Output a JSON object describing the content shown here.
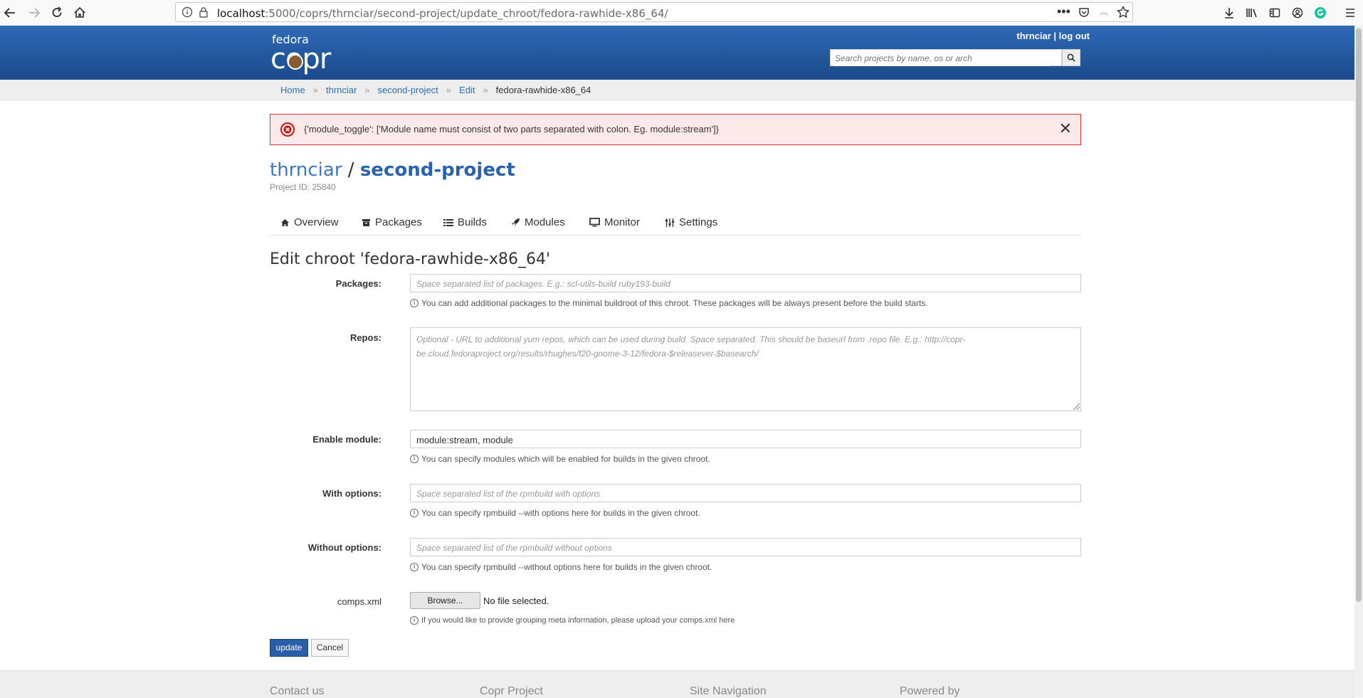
{
  "browser": {
    "url_host": "localhost",
    "url_rest": ":5000/coprs/thrnciar/second-project/update_chroot/fedora-rawhide-x86_64/"
  },
  "header": {
    "logo_top": "fedora",
    "logo_main": "copr",
    "username": "thrnciar",
    "separator": "|",
    "logout": "log out",
    "search_placeholder": "Search projects by name, os or arch"
  },
  "breadcrumb": {
    "items": [
      "Home",
      "thrnciar",
      "second-project",
      "Edit"
    ],
    "current": "fedora-rawhide-x86_64",
    "separator": "»"
  },
  "alert": {
    "message": "{'module_toggle': ['Module name must consist of two parts separated with colon. Eg. module:stream']}",
    "close": "✕"
  },
  "project": {
    "owner": "thrnciar",
    "slash": "/",
    "name": "second-project",
    "id_label": "Project ID: 25840"
  },
  "tabs": [
    {
      "label": "Overview",
      "icon": "home-icon"
    },
    {
      "label": "Packages",
      "icon": "archive-icon"
    },
    {
      "label": "Builds",
      "icon": "list-icon"
    },
    {
      "label": "Modules",
      "icon": "rocket-icon"
    },
    {
      "label": "Monitor",
      "icon": "monitor-icon"
    },
    {
      "label": "Settings",
      "icon": "sliders-icon"
    }
  ],
  "form": {
    "title": "Edit chroot 'fedora-rawhide-x86_64'",
    "packages": {
      "label": "Packages:",
      "placeholder": "Space separated list of packages. E.g.: scl-utils-build ruby193-build",
      "help": "You can add additional packages to the minimal buildroot of this chroot. These packages will be always present before the build starts."
    },
    "repos": {
      "label": "Repos:",
      "placeholder": "Optional - URL to additional yum repos, which can be used during build. Space separated. This should be baseurl from .repo file. E.g.: http://copr-be.cloud.fedoraproject.org/results/rhughes/f20-gnome-3-12/fedora-$releasever-$basearch/"
    },
    "enable_module": {
      "label": "Enable module:",
      "value": "module:stream, module",
      "help": "You can specify modules which will be enabled for builds in the given chroot."
    },
    "with_options": {
      "label": "With options:",
      "placeholder": "Space separated list of the rpmbuild with options",
      "help": "You can specify rpmbuild --with options here for builds in the given chroot."
    },
    "without_options": {
      "label": "Without options:",
      "placeholder": "Space separated list of the rpmbuild without options",
      "help": "You can specify rpmbuild --without options here for builds in the given chroot."
    },
    "comps": {
      "label": "comps.xml",
      "browse": "Browse...",
      "no_file": "No file selected.",
      "help": "If you would like to provide grouping meta information, please upload your comps.xml here"
    },
    "update_label": "update",
    "cancel_label": "Cancel"
  },
  "footer": {
    "columns": [
      "Contact us",
      "Copr Project",
      "Site Navigation",
      "Powered by"
    ]
  }
}
